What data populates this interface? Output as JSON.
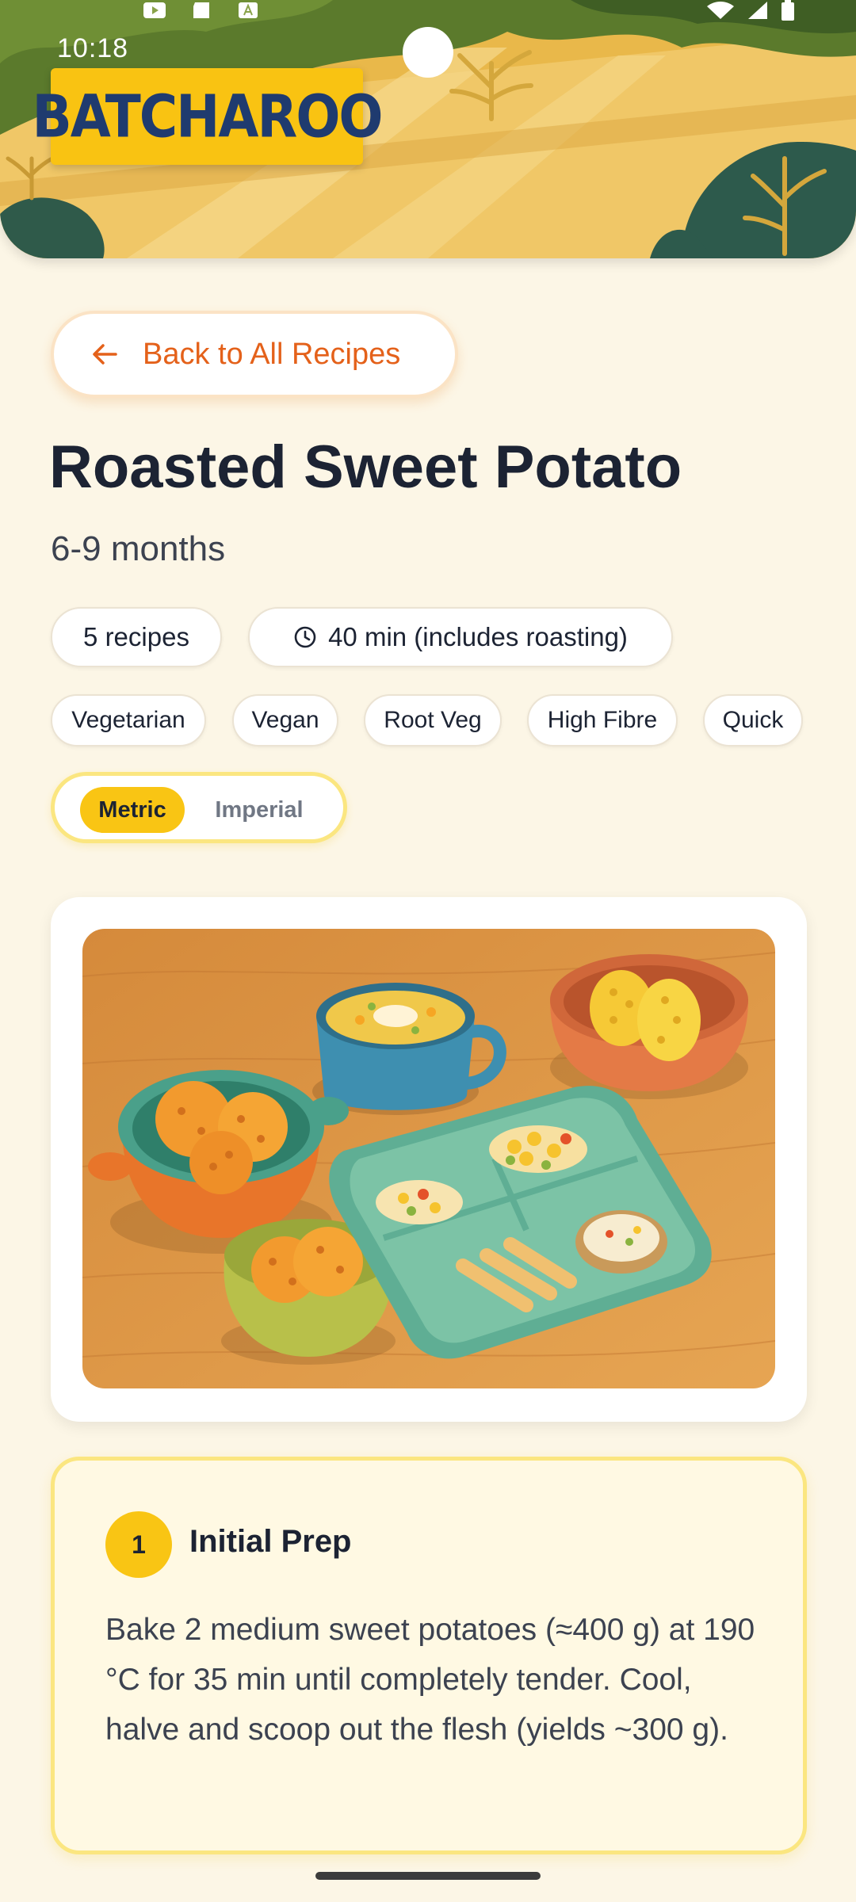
{
  "status_bar": {
    "time": "10:18"
  },
  "header": {
    "logo_text": "BATCHAROO"
  },
  "back_button": {
    "label": "Back to All Recipes"
  },
  "recipe": {
    "title": "Roasted Sweet Potato",
    "age_range": "6-9 months",
    "recipes_count": "5 recipes",
    "time": "40 min (includes roasting)",
    "tags": [
      "Vegetarian",
      "Vegan",
      "Root Veg",
      "High Fibre",
      "Quick"
    ]
  },
  "units": {
    "metric_label": "Metric",
    "imperial_label": "Imperial",
    "selected": "Metric"
  },
  "step": {
    "number": "1",
    "title": "Initial Prep",
    "body": "Bake 2 medium sweet potatoes (≈400 g) at 190 °C for 35 min until completely tender. Cool, halve and scoop out the flesh (yields ~300 g)."
  },
  "colors": {
    "accent_orange": "#e4611a",
    "accent_yellow": "#f9c514",
    "logo_blue": "#1f3b6f",
    "text_dark": "#1c2333"
  },
  "icons": {
    "back": "arrow-left-icon",
    "time": "clock-icon"
  }
}
